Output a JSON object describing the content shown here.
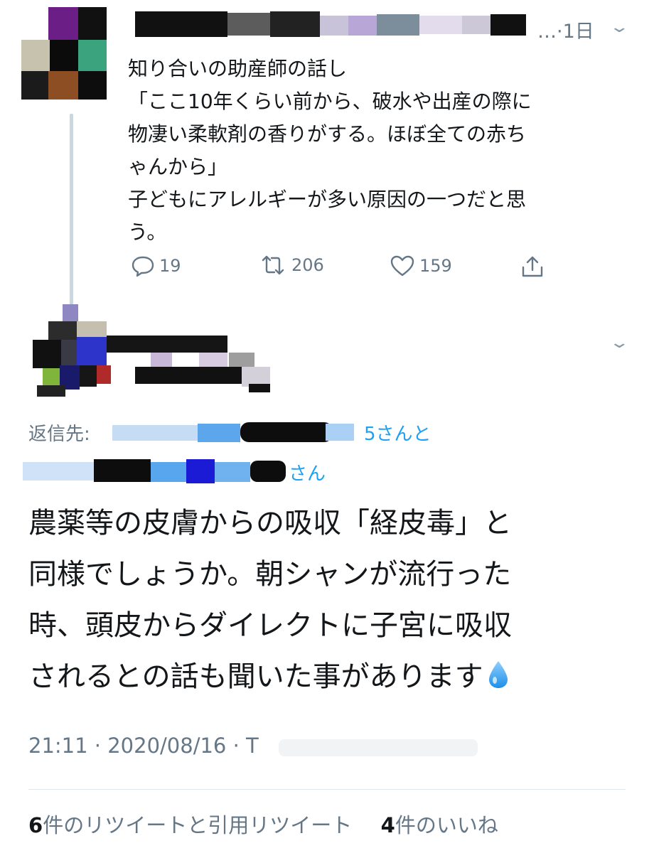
{
  "tweet1": {
    "time": "…·1日",
    "lines": [
      "知り合いの助産師の話し",
      "「ここ10年くらい前から、破水や出産の際に",
      "物凄い柔軟剤の香りがする。ほぼ全ての赤ち",
      "ゃんから」",
      "子どもにアレルギーが多い原因の一つだと思",
      "う。"
    ],
    "actions": {
      "reply_count": "19",
      "retweet_count": "206",
      "like_count": "159"
    }
  },
  "tweet2": {
    "reply_prefix": "返信先:",
    "reply_mention_1_suffix": "5さんと",
    "reply_mention_2_suffix": "さん",
    "lines": [
      "農薬等の皮膚からの吸収「経皮毒」と",
      "同様でしょうか。朝シャンが流行った",
      "時、頭皮からダイレクトに子宮に吸収",
      "されるとの話も聞いた事があります"
    ],
    "emoji": "💧",
    "timestamp": "21:11 · 2020/08/16 · T",
    "retweet_count": "6",
    "retweet_label": "件のリツイートと引用リツイート",
    "like_count": "4",
    "like_label": "件のいいね"
  },
  "colors": {
    "text": "#14171a",
    "secondary": "#657786",
    "link": "#1da1f2",
    "divider": "#e1e8ed",
    "thread_line": "#ccd6dd"
  },
  "icons": {
    "reply": "speech-bubble-icon",
    "retweet": "retweet-arrows-icon",
    "like": "heart-outline-icon",
    "share": "share-upload-icon",
    "more": "chevron-down-icon",
    "emoji": "droplet-emoji"
  }
}
